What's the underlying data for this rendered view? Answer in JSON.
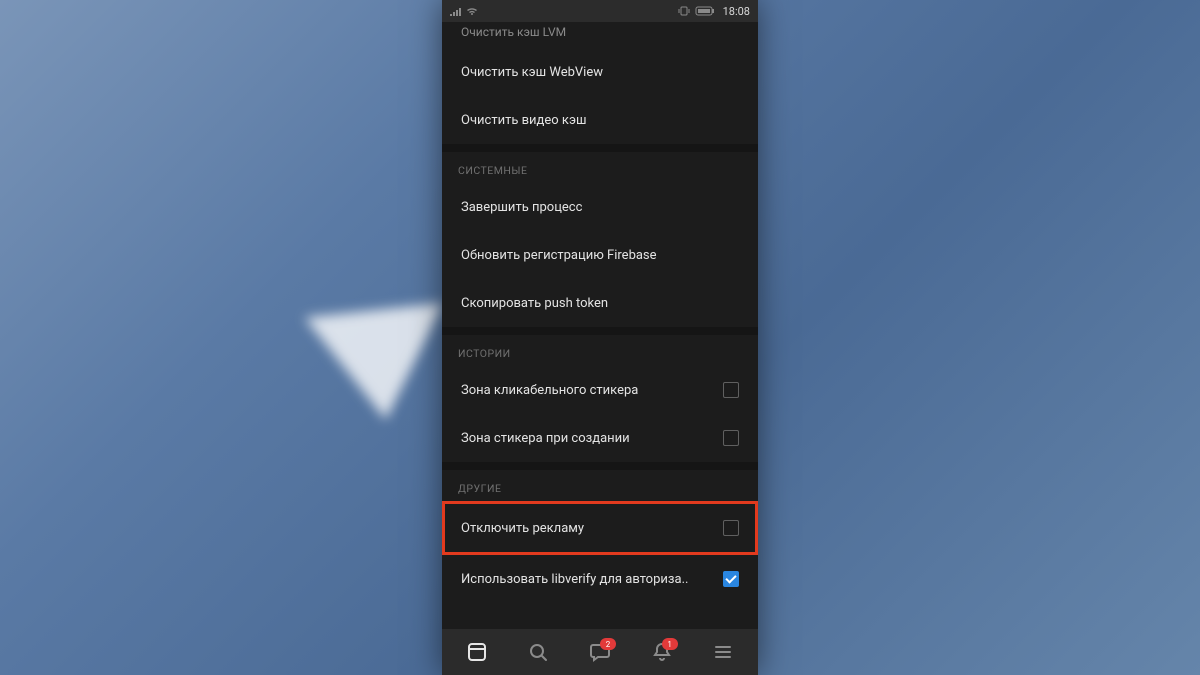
{
  "statusbar": {
    "time": "18:08"
  },
  "partial_row_label": "Очистить кэш LVM",
  "cache_section": {
    "items": [
      {
        "label": "Очистить кэш WebView"
      },
      {
        "label": "Очистить видео кэш"
      }
    ]
  },
  "system_section": {
    "header": "СИСТЕМНЫЕ",
    "items": [
      {
        "label": "Завершить процесс"
      },
      {
        "label": "Обновить регистрацию Firebase"
      },
      {
        "label": "Скопировать push token"
      }
    ]
  },
  "stories_section": {
    "header": "ИСТОРИИ",
    "items": [
      {
        "label": "Зона кликабельного стикера",
        "checked": false
      },
      {
        "label": "Зона стикера при создании",
        "checked": false
      }
    ]
  },
  "other_section": {
    "header": "ДРУГИЕ",
    "items": [
      {
        "label": "Отключить рекламу",
        "checked": false,
        "highlighted": true
      },
      {
        "label": "Использовать libverify для авториза..",
        "checked": true
      }
    ]
  },
  "bottomnav": {
    "badges": {
      "messages": "2",
      "notifications": "1"
    }
  },
  "colors": {
    "highlight_border": "#e23a1e",
    "checkbox_checked": "#2a86e0",
    "badge": "#e23a3a"
  }
}
